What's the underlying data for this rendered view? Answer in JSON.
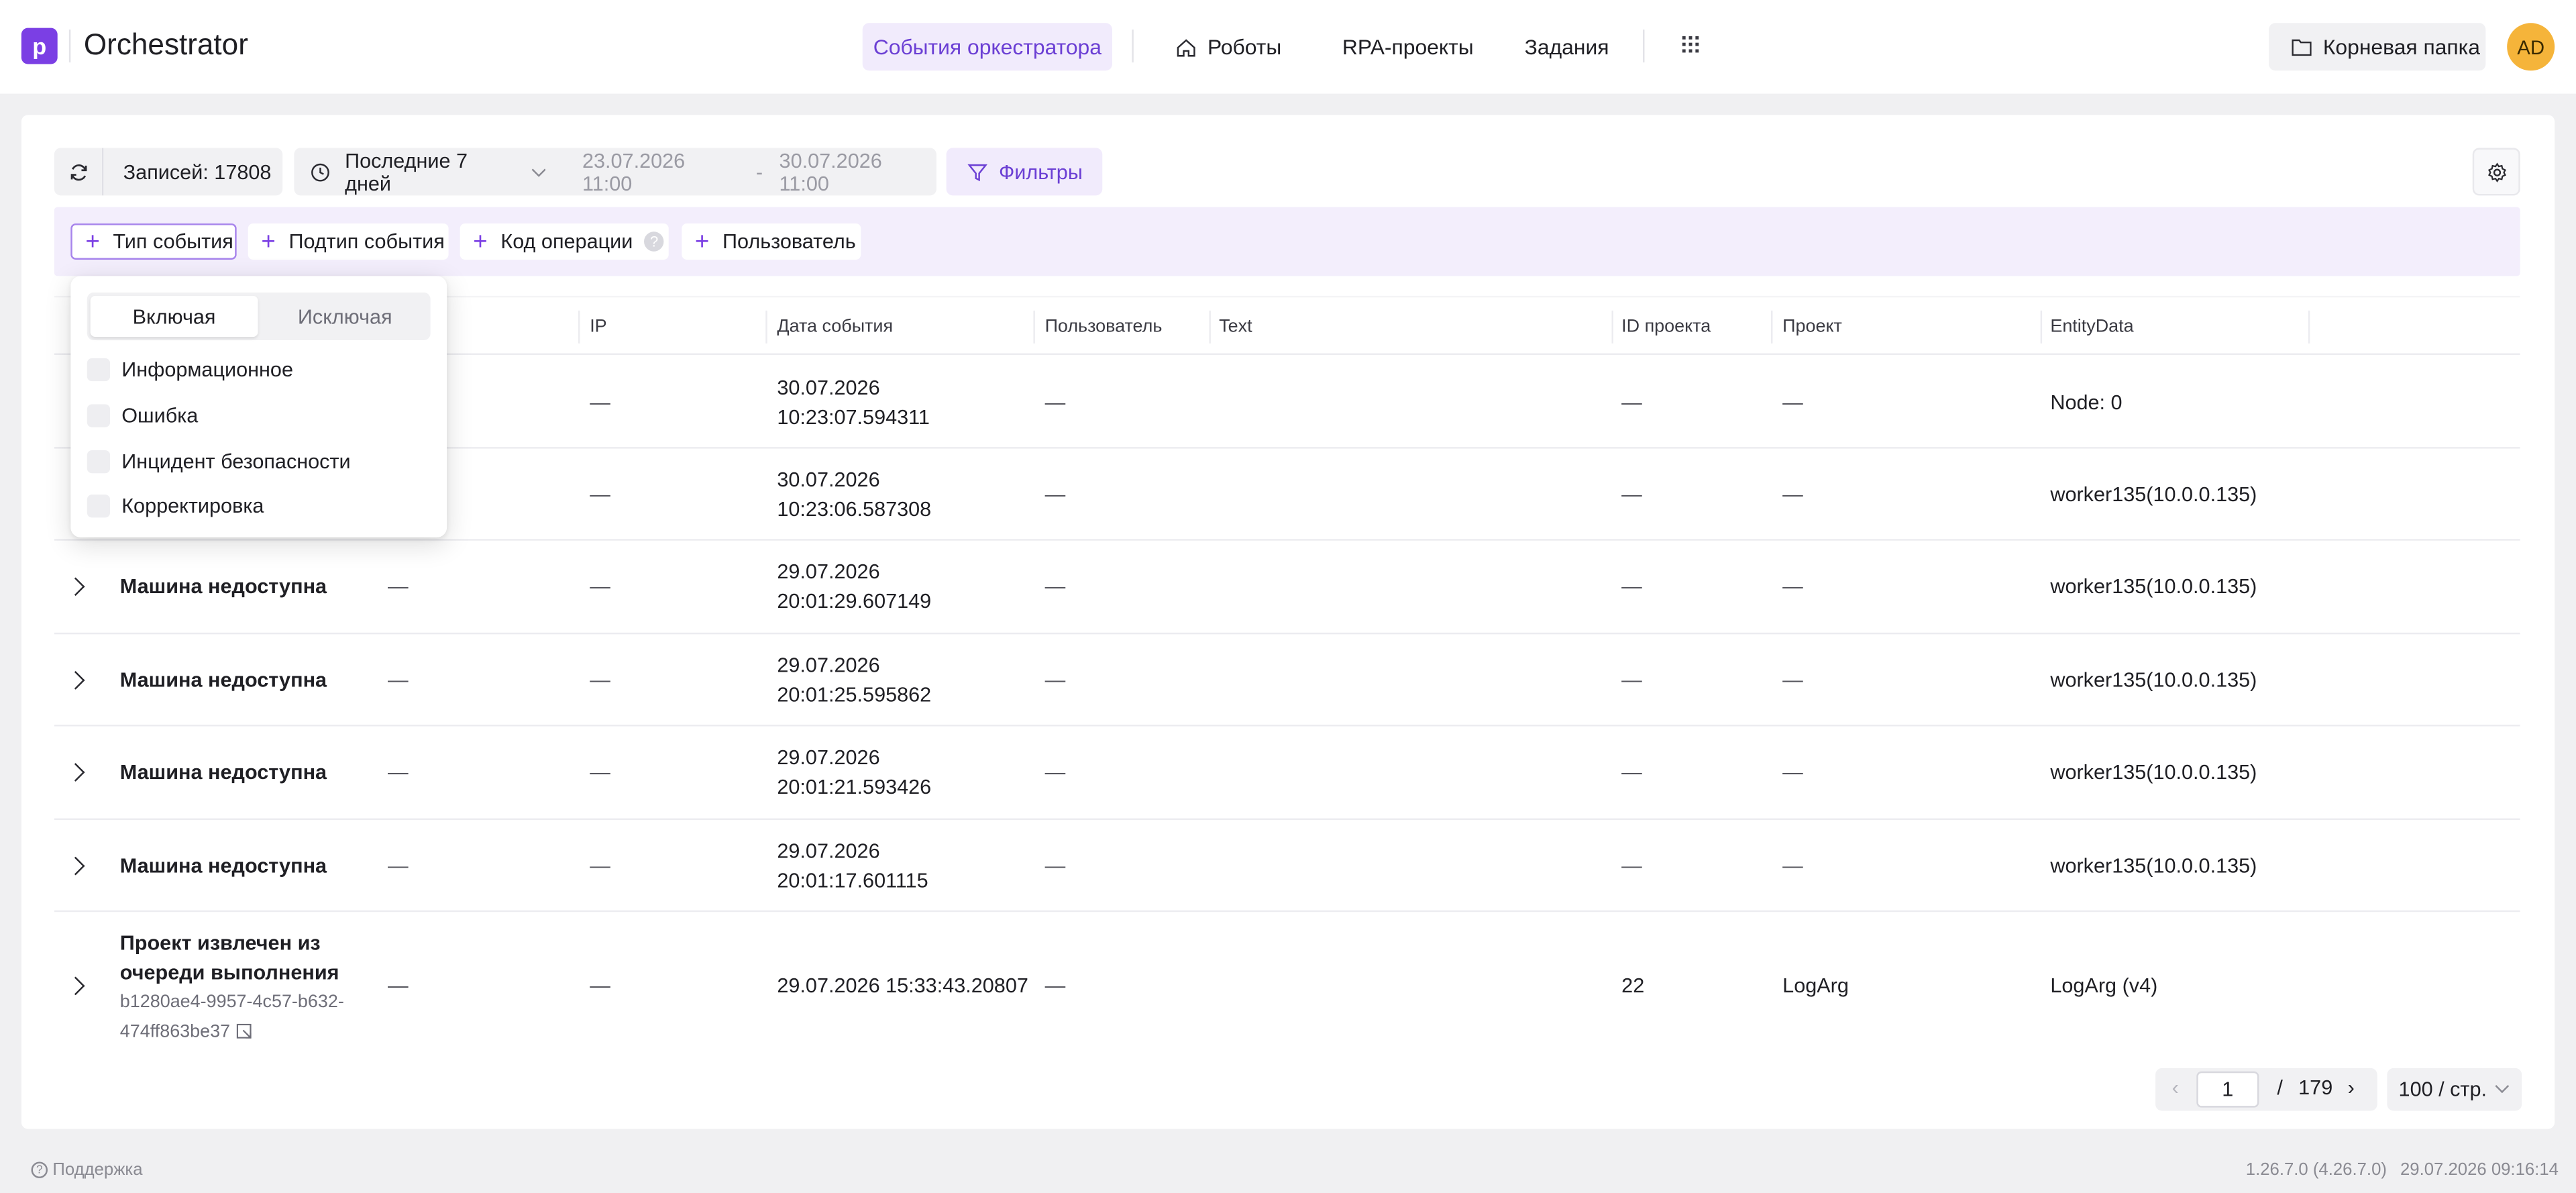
{
  "app": {
    "logo_letter": "p",
    "title": "Orchestrator"
  },
  "nav": {
    "events": "События оркестратора",
    "robots": "Роботы",
    "rpa_projects": "RPA-проекты",
    "tasks": "Задания",
    "root_folder": "Корневая папка",
    "avatar": "AD"
  },
  "toolbar": {
    "records": "Записей: 17808",
    "period": "Последние 7 дней",
    "date_from": "23.07.2026 11:00",
    "date_sep": "-",
    "date_to": "30.07.2026 11:00",
    "filters": "Фильтры"
  },
  "filter_chips": {
    "event_type": "Тип события",
    "event_subtype": "Подтип события",
    "operation_code": "Код операции",
    "user": "Пользователь"
  },
  "popover": {
    "include": "Включая",
    "exclude": "Исключая",
    "options": [
      "Информационное",
      "Ошибка",
      "Инцидент безопасности",
      "Корректировка"
    ]
  },
  "table": {
    "columns": [
      "IP",
      "Дата события",
      "Пользователь",
      "Text",
      "ID проекта",
      "Проект",
      "EntityData"
    ],
    "rows": [
      {
        "name": "",
        "sub": "",
        "c1": "—",
        "ip": "—",
        "date": "30.07.2026",
        "time": "10:23:07.594311",
        "user": "—",
        "pid": "—",
        "project": "—",
        "entity": "Node: 0"
      },
      {
        "name": "",
        "sub": "",
        "c1": "—",
        "ip": "—",
        "date": "30.07.2026",
        "time": "10:23:06.587308",
        "user": "—",
        "pid": "—",
        "project": "—",
        "entity": "worker135(10.0.0.135)"
      },
      {
        "name": "Машина недоступна",
        "sub": "",
        "c1": "—",
        "ip": "—",
        "date": "29.07.2026",
        "time": "20:01:29.607149",
        "user": "—",
        "pid": "—",
        "project": "—",
        "entity": "worker135(10.0.0.135)"
      },
      {
        "name": "Машина недоступна",
        "sub": "",
        "c1": "—",
        "ip": "—",
        "date": "29.07.2026",
        "time": "20:01:25.595862",
        "user": "—",
        "pid": "—",
        "project": "—",
        "entity": "worker135(10.0.0.135)"
      },
      {
        "name": "Машина недоступна",
        "sub": "",
        "c1": "—",
        "ip": "—",
        "date": "29.07.2026",
        "time": "20:01:21.593426",
        "user": "—",
        "pid": "—",
        "project": "—",
        "entity": "worker135(10.0.0.135)"
      },
      {
        "name": "Машина недоступна",
        "sub": "",
        "c1": "—",
        "ip": "—",
        "date": "29.07.2026",
        "time": "20:01:17.601115",
        "user": "—",
        "pid": "—",
        "project": "—",
        "entity": "worker135(10.0.0.135)"
      },
      {
        "name_line1": "Проект извлечен из",
        "name_line2": "очереди выполнения",
        "sub_line1": "b1280ae4-9957-4c57-b632-",
        "sub_line2": "474ff863be37",
        "c1": "—",
        "ip": "—",
        "datetime": "29.07.2026 15:33:43.20807",
        "user": "—",
        "pid": "22",
        "project": "LogArg",
        "entity": "LogArg (v4)"
      }
    ]
  },
  "pagination": {
    "page": "1",
    "slash": "/",
    "total": "179",
    "page_size": "100 / стр."
  },
  "footer": {
    "support": "Поддержка",
    "version": "1.26.7.0 (4.26.7.0)",
    "datetime": "29.07.2026 09:16:14"
  },
  "colors": {
    "accent": "#7b3fe4",
    "accent_bg": "#f1ebfc",
    "filter_row_bg": "#f3eefc",
    "avatar_bg": "#f5b43a"
  }
}
